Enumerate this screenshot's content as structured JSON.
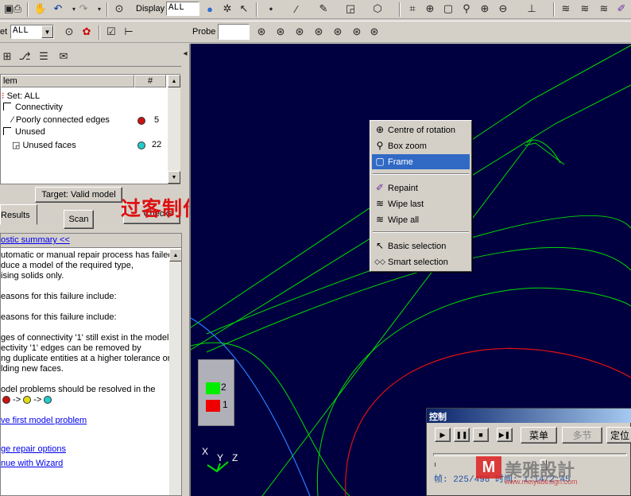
{
  "toolbar1": {
    "display_label": "Display",
    "display_value": "ALL",
    "icons": [
      "save-icon",
      "print-icon",
      "hand-icon",
      "undo-icon",
      "redo-icon",
      "binoculars-icon",
      "globe-icon",
      "gear-icon",
      "pointer-icon",
      "point-icon",
      "line-icon",
      "edit-icon",
      "face-icon",
      "solid-icon",
      "fit-icon",
      "rotate-icon",
      "frame-icon",
      "zoom-icon",
      "zoom-in-icon",
      "zoom-out-icon",
      "axis-icon",
      "repaint-icon",
      "wipe-last-icon",
      "wipe-all-icon"
    ]
  },
  "toolbar2": {
    "set_label": "et",
    "set_value": "ALL",
    "probe_label": "Probe",
    "probe_value": ""
  },
  "left_panel": {
    "col_item": "lem",
    "col_count": "#",
    "tree": [
      {
        "label": "Set: ALL",
        "count": ""
      },
      {
        "label": "Connectivity",
        "count": ""
      },
      {
        "label": "Poorly connected edges",
        "count": "5",
        "color": "#cc1111"
      },
      {
        "label": "Unused",
        "count": ""
      },
      {
        "label": "Unused faces",
        "count": "22",
        "color": "#22cccc"
      }
    ],
    "target_button": "Target: Valid model",
    "results_tab": "Results",
    "scan_button": "Scan",
    "checks_button": "Checks",
    "watermark": "过客制作",
    "diag_link": "ostic summary <<",
    "diag_lines": [
      "utomatic or manual repair process has failed",
      "duce a model of the required type,",
      "ising solids only.",
      "",
      "easons for this failure include:",
      "",
      "easons for this failure include:",
      "",
      "ges of connectivity '1' still exist in the model.",
      "ectivity '1' edges can be removed by",
      "ng duplicate entities at a higher tolerance or",
      "lding new faces.",
      "",
      "odel problems should be resolved in the"
    ],
    "link_first_problem": "ve first model problem",
    "link_repair_options": "ge repair options",
    "link_wizard": "nue with Wizard"
  },
  "legend": [
    {
      "label": "2",
      "color": "#00ee00"
    },
    {
      "label": "1",
      "color": "#ee0000"
    }
  ],
  "axes": {
    "x": "X",
    "y": "Y",
    "z": "Z"
  },
  "context_menu": {
    "items": [
      {
        "label": "Centre of rotation",
        "icon": "rotate-icon"
      },
      {
        "label": "Box zoom",
        "icon": "zoom-icon"
      },
      {
        "label": "Frame",
        "icon": "frame-icon",
        "selected": true
      },
      {
        "label": "Repaint",
        "icon": "repaint-icon"
      },
      {
        "label": "Wipe last",
        "icon": "wipe-last-icon"
      },
      {
        "label": "Wipe all",
        "icon": "wipe-all-icon"
      },
      {
        "label": "Basic selection",
        "icon": "arrow-icon"
      },
      {
        "label": "Smart selection",
        "icon": "smart-select-icon"
      }
    ]
  },
  "control_window": {
    "title": "控制",
    "menu_button": "菜单",
    "multi_button": "多节",
    "locate_button": "定位",
    "frame_readout": "帧: 225/498  时间: 1:14/2:45",
    "brand": "美雅設計",
    "brand_url": "www.meiyadesign.com"
  }
}
